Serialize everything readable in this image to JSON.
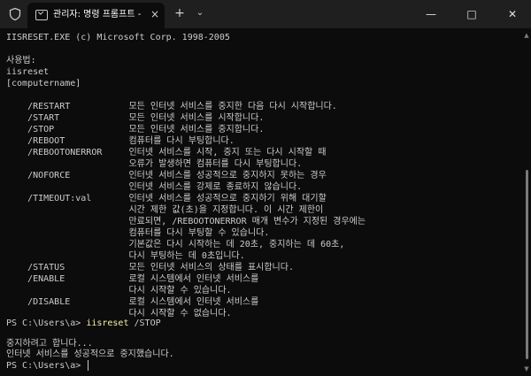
{
  "title_bar": {
    "shield_icon": "shield-icon",
    "tab_title": "관리자: 명령 프롬프트 - power",
    "tab_icon": "terminal-icon",
    "close_tab_icon": "×",
    "new_tab_icon": "+",
    "dropdown_icon": "⌄",
    "minimize_icon": "—",
    "maximize_icon": "□",
    "close_icon": "✕"
  },
  "terminal": {
    "lines": [
      "IISRESET.EXE (c) Microsoft Corp. 1998-2005",
      "",
      "사용법:",
      "iisreset",
      "[computername]",
      "",
      "    /RESTART           모든 인터넷 서비스를 중지한 다음 다시 시작합니다.",
      "    /START             모든 인터넷 서비스를 시작합니다.",
      "    /STOP              모든 인터넷 서비스를 중지합니다.",
      "    /REBOOT            컴퓨터를 다시 부팅합니다.",
      "    /REBOOTONERROR     인터넷 서비스를 시작, 중지 또는 다시 시작할 때",
      "                       오류가 발생하면 컴퓨터를 다시 부팅합니다.",
      "    /NOFORCE           인터넷 서비스를 성공적으로 중지하지 못하는 경우",
      "                       인터넷 서비스를 강제로 종료하지 않습니다.",
      "    /TIMEOUT:val       인터넷 서비스를 성공적으로 중지하기 위해 대기할",
      "                       시간 제한 값(초)을 지정합니다. 이 시간 제한이",
      "                       만료되면, /REBOOTONERROR 매개 변수가 지정된 경우에는",
      "                       컴퓨터를 다시 부팅할 수 있습니다.",
      "                       기본값은 다시 시작하는 데 20초, 중지하는 데 60초,",
      "                       다시 부팅하는 데 0초입니다.",
      "    /STATUS            모든 인터넷 서비스의 상태를 표시합니다.",
      "    /ENABLE            로컬 시스템에서 인터넷 서비스를",
      "                       다시 시작할 수 있습니다.",
      "    /DISABLE           로컬 시스템에서 인터넷 서비스를",
      "                       다시 시작할 수 없습니다."
    ],
    "prompt1": "PS C:\\Users\\a> ",
    "command1": "iisreset",
    "command1_args": " /STOP",
    "output1": "중지하려고 합니다...",
    "output2": "인터넷 서비스를 성공적으로 중지했습니다.",
    "prompt2": "PS C:\\Users\\a> ",
    "colors": {
      "background": "#0c0c0c",
      "foreground": "#cccccc",
      "command": "#f9f1a5"
    }
  }
}
